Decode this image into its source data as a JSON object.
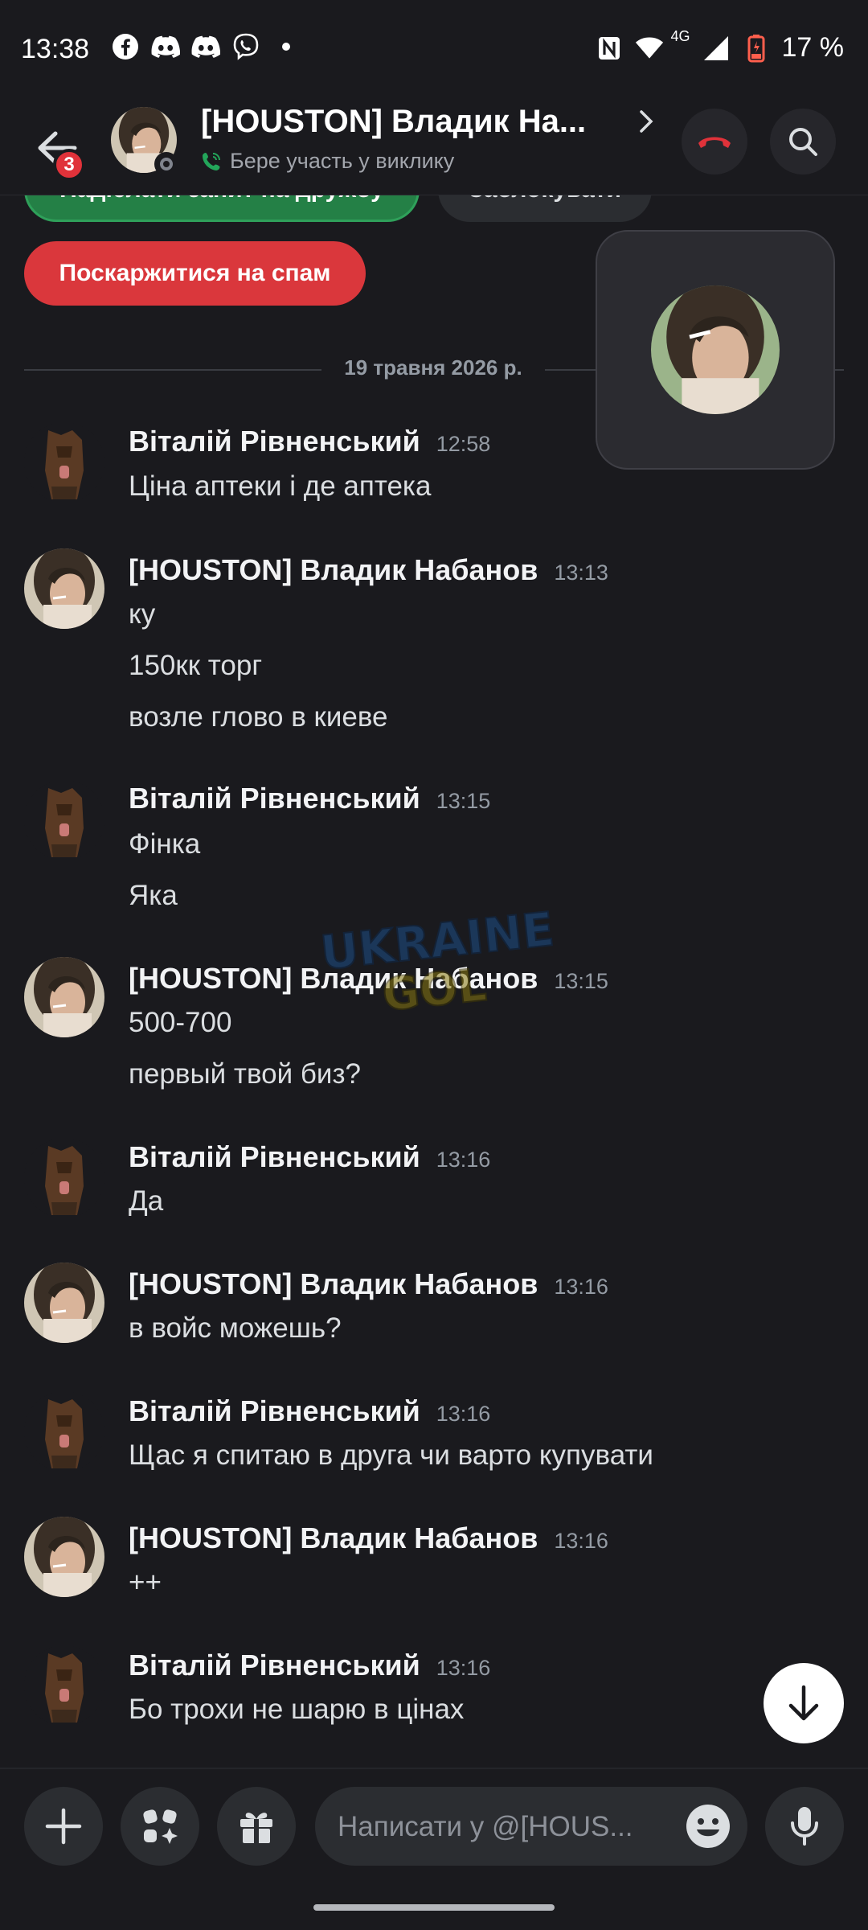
{
  "status_bar": {
    "time": "13:38",
    "network": "4G",
    "battery": "17 %",
    "icons": [
      "facebook-icon",
      "discord-icon",
      "discord-icon",
      "viber-icon",
      "dot-icon",
      "nfc-icon",
      "wifi-icon",
      "signal-icon",
      "battery-icon"
    ]
  },
  "header": {
    "back_badge": "3",
    "title": "[HOUSTON] Владик На...",
    "subtitle": "Бере участь у виклику"
  },
  "actions": {
    "friend_request": "Надіслати запит на дружбу",
    "block": "Заблокувати",
    "report_spam": "Поскаржитися на спам"
  },
  "date_divider": "19 травня 2026 р.",
  "messages": [
    {
      "author": "Віталій Рівненський",
      "time": "12:58",
      "lines": [
        "Ціна аптеки і де аптека"
      ]
    },
    {
      "author": "[HOUSTON] Владик Набанов",
      "time": "13:13",
      "lines": [
        "ку",
        "150кк торг",
        "возле глово в киеве"
      ]
    },
    {
      "author": "Віталій Рівненський",
      "time": "13:15",
      "lines": [
        "Фінка",
        "Яка"
      ]
    },
    {
      "author": "[HOUSTON] Владик Набанов",
      "time": "13:15",
      "lines": [
        "500-700",
        "первый твой биз?"
      ]
    },
    {
      "author": "Віталій Рівненський",
      "time": "13:16",
      "lines": [
        "Да"
      ]
    },
    {
      "author": "[HOUSTON] Владик Набанов",
      "time": "13:16",
      "lines": [
        "в войс можешь?"
      ]
    },
    {
      "author": "Віталій Рівненський",
      "time": "13:16",
      "lines": [
        "Щас я спитаю в друга чи варто купувати"
      ]
    },
    {
      "author": "[HOUSTON] Владик Набанов",
      "time": "13:16",
      "lines": [
        "++"
      ]
    },
    {
      "author": "Віталій Рівненський",
      "time": "13:16",
      "lines": [
        "Бо трохи не шарю в цінах"
      ]
    }
  ],
  "watermark": {
    "line1": "UKRAINE",
    "line2": "GOL"
  },
  "composer": {
    "placeholder": "Написати у @[HOUS..."
  },
  "colors": {
    "background": "#1a1a1e",
    "green_pill": "#248046",
    "red_pill": "#da373c",
    "badge": "#e0323a",
    "hangup": "#e0323a",
    "call_green": "#23a55a"
  }
}
